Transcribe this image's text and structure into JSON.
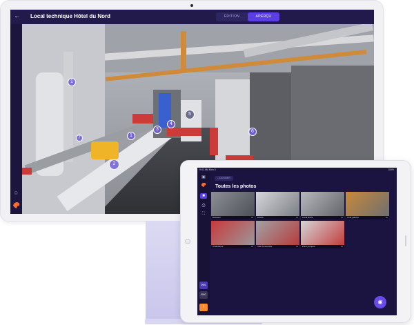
{
  "desktop": {
    "back_icon": "arrow-left-icon",
    "title": "Local technique Hôtel du Nord",
    "segments": [
      "ÉDITION",
      "APERÇU"
    ],
    "active_segment": 1,
    "hotspots": [
      "1",
      "1",
      "2",
      "3",
      "4",
      "5",
      "6",
      "7"
    ],
    "colors": {
      "accent": "#5b3ee6",
      "background": "#1a1538",
      "logo": "#ff6b2c"
    }
  },
  "tablet": {
    "status_time": "9:41 AM",
    "status_date": "Mon 3",
    "status_battery": "100%",
    "breadcrumb": "DOSSIER",
    "title": "Toutes les photos",
    "sidebar_badges": [
      "DWL",
      "ENG"
    ],
    "photos": [
      {
        "label": "Extérieur"
      },
      {
        "label": "Entrée"
      },
      {
        "label": "Local droite"
      },
      {
        "label": "Coté gauche"
      },
      {
        "label": "Chaudières"
      },
      {
        "label": "Vue d'ensemble"
      },
      {
        "label": "Zone pompes"
      }
    ],
    "fab_icon": "camera-icon"
  }
}
